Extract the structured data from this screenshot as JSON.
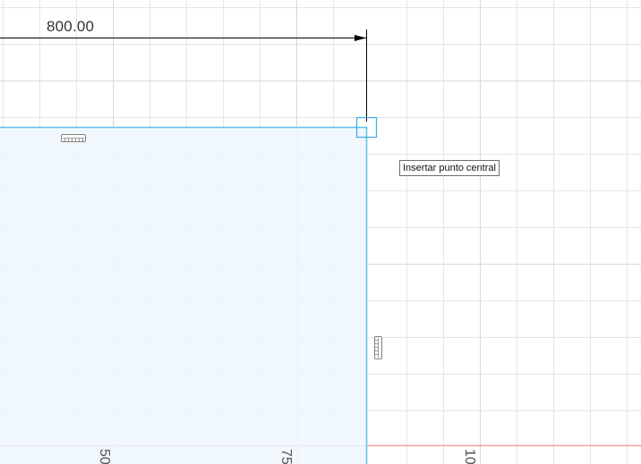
{
  "sketch": {
    "dimension_value": "800.00",
    "tooltip": "Insertar punto central",
    "axis_labels": [
      "50",
      "75",
      "10"
    ]
  },
  "colors": {
    "grid_line": "#e6e6e6",
    "rectangle_stroke": "#63c4ec",
    "rectangle_fill": "#eef7fd",
    "x_axis": "#f2a0a6",
    "dimension_line": "#000000",
    "constraint_glyph": "#7f7f7f"
  },
  "icons": {
    "corner_handle": "square-point-icon",
    "horizontal_constraint": "horizontal-constraint-icon",
    "vertical_constraint": "vertical-constraint-icon",
    "dimension_arrow": "arrow-right-icon"
  }
}
